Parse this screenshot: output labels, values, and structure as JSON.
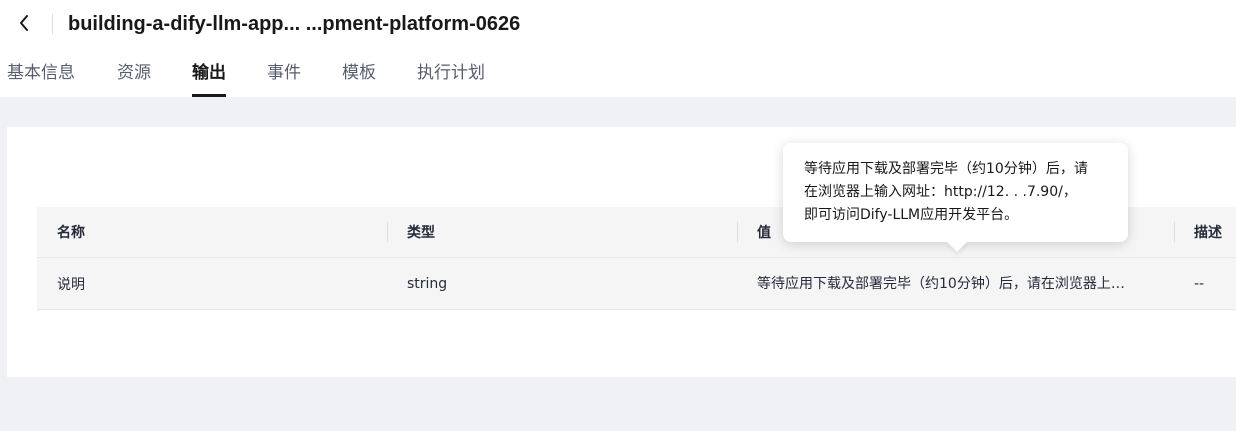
{
  "header": {
    "back_icon": "chevron-left-icon",
    "title": "building-a-dify-llm-app... ...pment-platform-0626"
  },
  "tabs": [
    {
      "label": "基本信息",
      "active": false
    },
    {
      "label": "资源",
      "active": false
    },
    {
      "label": "输出",
      "active": true
    },
    {
      "label": "事件",
      "active": false
    },
    {
      "label": "模板",
      "active": false
    },
    {
      "label": "执行计划",
      "active": false
    }
  ],
  "table": {
    "columns": [
      "名称",
      "类型",
      "值",
      "描述"
    ],
    "rows": [
      {
        "name": "说明",
        "type": "string",
        "value": "等待应用下载及部署完毕（约10分钟）后，请在浏览器上…",
        "description": "--"
      }
    ]
  },
  "tooltip": {
    "lines": [
      "等待应用下载及部署完毕（约10分钟）后，请",
      "在浏览器上输入网址：http://12.  .  .7.90/，",
      "即可访问Dify-LLM应用开发平台。"
    ]
  },
  "colors": {
    "background_gray": "#f0f1f5",
    "active_tab": "#191919",
    "inactive_tab": "#575d6c"
  }
}
